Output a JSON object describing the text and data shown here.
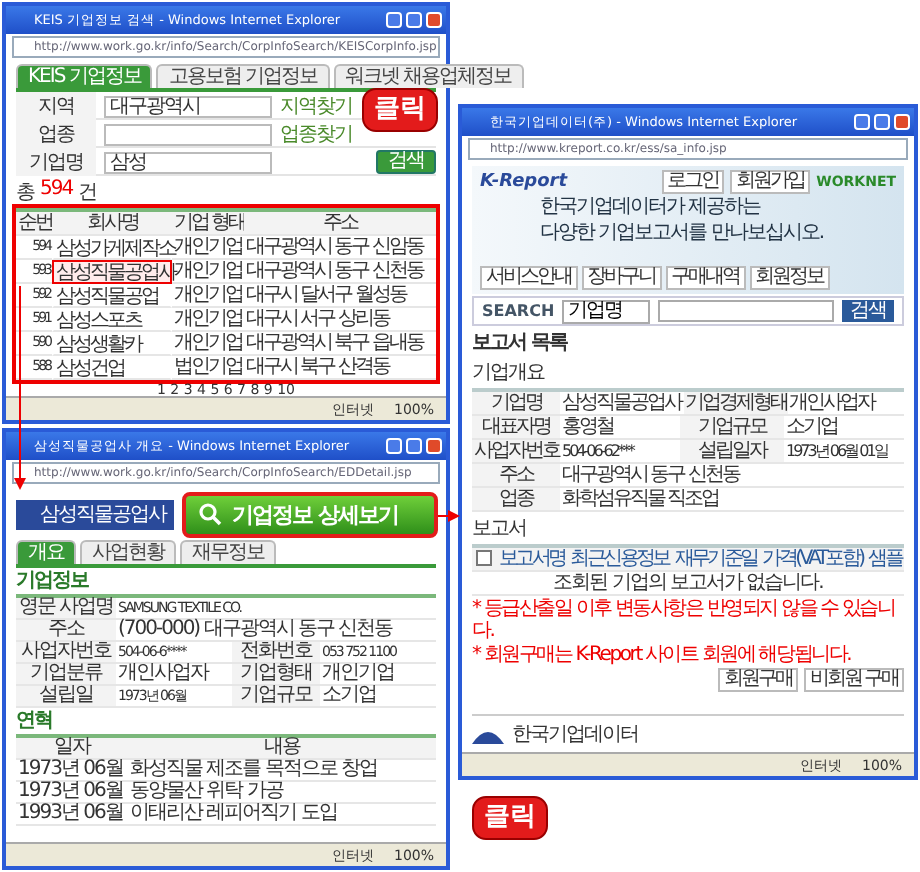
{
  "search_window": {
    "title": "KEIS 기업정보 검색 - Windows Internet Explorer",
    "address": "http://www.work.go.kr/info/Search/CorpInfoSearch/KEISCorpInfo.jsp",
    "tabs": [
      {
        "label": "KEIS 기업정보",
        "selected": true
      },
      {
        "label": "고용보험 기업정보",
        "selected": false
      },
      {
        "label": "워크넷 채용업체정보",
        "selected": false
      }
    ],
    "form": [
      {
        "label": "지역",
        "value": "대구광역시",
        "action": "지역찾기"
      },
      {
        "label": "업종",
        "action": "업종찾기"
      },
      {
        "label": "기업명",
        "value": "삼성"
      }
    ],
    "search_button": "검색",
    "total": {
      "prefix": "총",
      "count": "594",
      "suffix": "건"
    },
    "columns": [
      "순번",
      "회사명",
      "기업 형태",
      "주소"
    ],
    "rows": [
      {
        "cells": [
          "594",
          "삼성가게제작소",
          "개인기업",
          "대구광역시 동구 신암동"
        ],
        "selected": false
      },
      {
        "cells": [
          "593",
          "삼성직물공업사",
          "개인기업",
          "대구광역시 동구 신천동"
        ],
        "selected": true
      },
      {
        "cells": [
          "592",
          "삼성직물공업",
          "개인기업",
          "대구시 달서구 월성동"
        ],
        "selected": false
      },
      {
        "cells": [
          "591",
          "삼성스포츠",
          "개인기업",
          "대구시 서구 상리동"
        ],
        "selected": false
      },
      {
        "cells": [
          "590",
          "삼성생활카",
          "개인기업",
          "대구광역시 북구 읍내동"
        ],
        "selected": false
      },
      {
        "cells": [
          "588",
          "삼성건업",
          "법인기업",
          "대구시 북구 산격동"
        ],
        "selected": false
      }
    ],
    "pager": "1 2 3 4 5 6 7 8 9 10",
    "status": "인터넷",
    "zoom": "100%"
  },
  "callouts": [
    "클릭",
    "클릭"
  ],
  "detail_window": {
    "title": "삼성직물공업사 개요 - Windows Internet Explorer",
    "address": "http://www.work.go.kr/info/Search/CorpInfoSearch/EDDetail.jsp",
    "heading": "삼성직물공업사",
    "tabs": [
      {
        "label": "개요",
        "selected": true
      },
      {
        "label": "사업현황",
        "selected": false
      },
      {
        "label": "재무정보",
        "selected": false
      }
    ],
    "info_title": "기업정보",
    "info": [
      [
        {
          "label": "영문 사업명",
          "value": "SAMSUNG TEXTILE CO."
        }
      ],
      [
        {
          "label": "주소",
          "value": "(700-000) 대구광역시 동구 신천동"
        }
      ],
      [
        {
          "label": "사업자번호",
          "value": "504-06-6****"
        },
        {
          "label": "전화번호",
          "value": "053 752 1100"
        }
      ],
      [
        {
          "label": "기업분류",
          "value": "개인사업자"
        },
        {
          "label": "기업형태",
          "value": "개인기업"
        }
      ],
      [
        {
          "label": "설립일",
          "value": "1973년 06월"
        },
        {
          "label": "기업규모",
          "value": "소기업"
        }
      ]
    ],
    "history_title": "연혁",
    "history_columns": [
      "일자",
      "내용"
    ],
    "history": [
      [
        "1973년 06월",
        "화성직물 제조를 목적으로 창업"
      ],
      [
        "1973년 06월",
        "동양물산 위탁 가공"
      ],
      [
        "1993년 06월",
        "이태리산 레피어직기 도입"
      ]
    ],
    "status": "인터넷",
    "zoom": "100%"
  },
  "detail_button": "기업정보 상세보기",
  "report_window": {
    "title": "한국기업데이터(주) - Windows Internet Explorer",
    "address": "http://www.kreport.co.kr/ess/sa_info.jsp",
    "logo": "K-Report",
    "partner": "WORKNET",
    "slogan": [
      "한국기업데이터가 제공하는",
      "다양한 기업보고서를 만나보십시오."
    ],
    "nav": [
      "서비스안내",
      "장바구니",
      "구매내역",
      "회원정보"
    ],
    "account": [
      "로그인",
      "회원가입"
    ],
    "search_label": "SEARCH",
    "search_select": "기업명",
    "search_button": "검색",
    "list_title": "보고서 목록",
    "overview_title": "기업개요",
    "overview": [
      [
        {
          "label": "기업명",
          "value": "삼성직물공업사"
        },
        {
          "label": "기업경제형태",
          "value": "개인사업자"
        }
      ],
      [
        {
          "label": "대표자명",
          "value": "홍영철"
        },
        {
          "label": "기업규모",
          "value": "소기업"
        }
      ],
      [
        {
          "label": "사업자번호",
          "value": "504-06-62***"
        },
        {
          "label": "설립일자",
          "value": "1973년 06월 01일"
        }
      ],
      [
        {
          "label": "주소",
          "value": "대구광역시 동구 신천동"
        }
      ],
      [
        {
          "label": "업종",
          "value": "화학섬유직물 직조업"
        }
      ]
    ],
    "report_title": "보고서",
    "report_columns": [
      "보고서명",
      "최근신용정보",
      "재무기준일",
      "가격(VAT포함)",
      "샘플"
    ],
    "report_checked": false,
    "empty": "조회된 기업의 보고서가 없습니다.",
    "notes": [
      "* 등급산출일 이후 변동사항은 반영되지 않을 수 있습니다.",
      "* 회원구매는 K-Report 사이트 회원에 해당됩니다."
    ],
    "buy": [
      "회원구매",
      "비회원 구매"
    ],
    "footer": "한국기업데이터",
    "status": "인터넷",
    "zoom": "100%"
  }
}
